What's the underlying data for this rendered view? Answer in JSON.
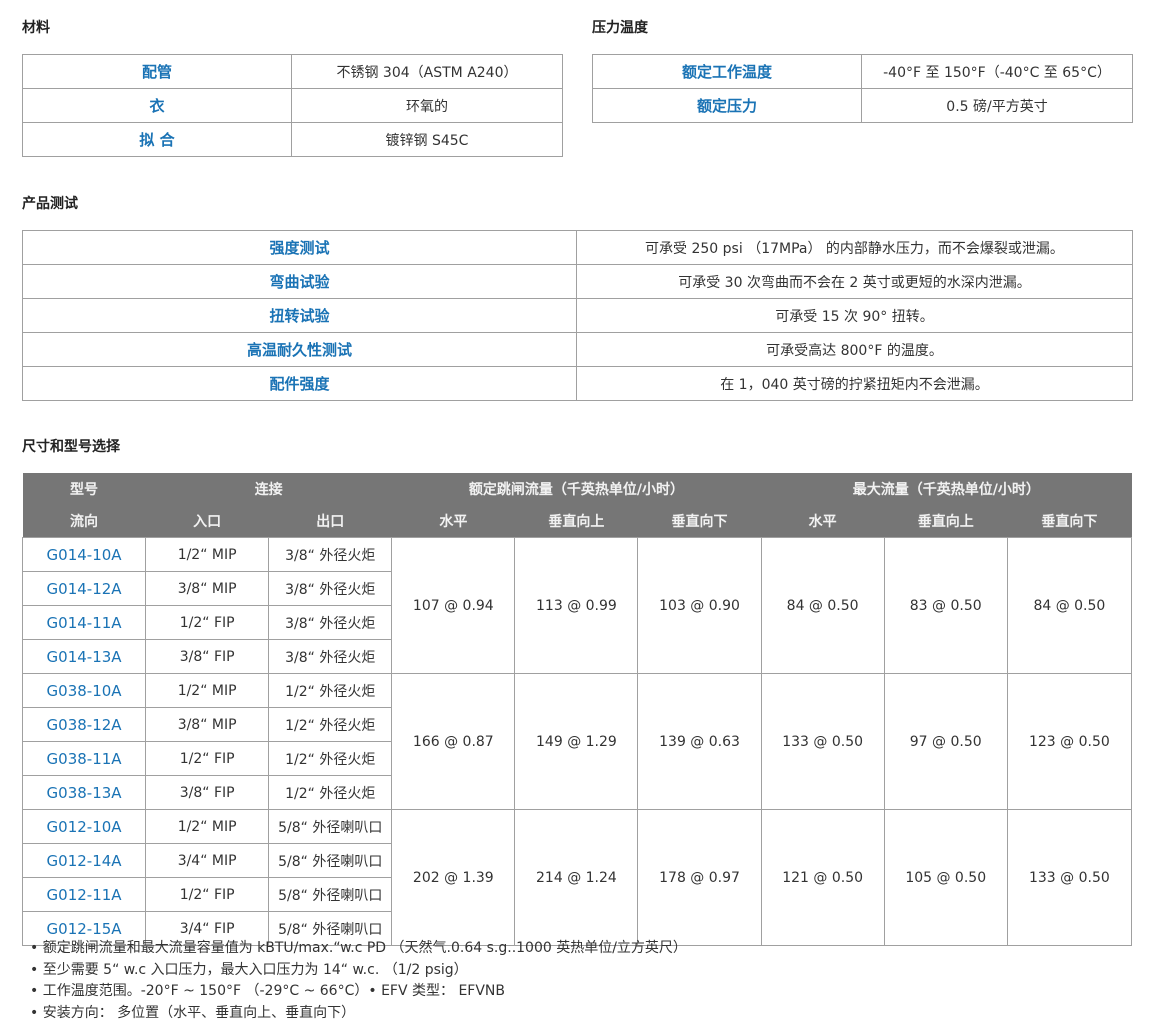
{
  "sections": {
    "materials": "材料",
    "pressure_temp": "压力温度",
    "product_test": "产品测试",
    "size_model": "尺寸和型号选择"
  },
  "materials": [
    {
      "label": "配管",
      "value": "不锈钢 304（ASTM A240）"
    },
    {
      "label": "衣",
      "value": "环氧的"
    },
    {
      "label": "拟 合",
      "value": "镀锌钢 S45C"
    }
  ],
  "pressure_temp": [
    {
      "label": "额定工作温度",
      "value": "-40°F 至 150°F（-40°C 至 65°C）"
    },
    {
      "label": "额定压力",
      "value": "0.5 磅/平方英寸"
    }
  ],
  "tests": [
    {
      "label": "强度测试",
      "value": "可承受 250 psi （17MPa） 的内部静水压力，而不会爆裂或泄漏。"
    },
    {
      "label": "弯曲试验",
      "value": "可承受 30 次弯曲而不会在 2 英寸或更短的水深内泄漏。"
    },
    {
      "label": "扭转试验",
      "value": "可承受 15 次 90° 扭转。"
    },
    {
      "label": "高温耐久性测试",
      "value": "可承受高达 800°F 的温度。"
    },
    {
      "label": "配件强度",
      "value": "在 1，040 英寸磅的拧紧扭矩内不会泄漏。"
    }
  ],
  "size_table": {
    "header1": {
      "model": "型号",
      "connection": "连接",
      "rated_flow": "额定跳闸流量（千英热单位/小时）",
      "max_flow": "最大流量（千英热单位/小时）"
    },
    "header2": {
      "flow_dir": "流向",
      "inlet": "入口",
      "outlet": "出口",
      "horizontal": "水平",
      "vertical_up": "垂直向上",
      "vertical_down": "垂直向下",
      "horizontal2": "水平",
      "vertical_up2": "垂直向上",
      "vertical_down2": "垂直向下"
    },
    "groups": [
      {
        "rows": [
          {
            "model": "G014-10A",
            "inlet": "1/2“ MIP",
            "outlet": "3/8“ 外径火炬"
          },
          {
            "model": "G014-12A",
            "inlet": "3/8“ MIP",
            "outlet": "3/8“ 外径火炬"
          },
          {
            "model": "G014-11A",
            "inlet": "1/2“ FIP",
            "outlet": "3/8“ 外径火炬"
          },
          {
            "model": "G014-13A",
            "inlet": "3/8“ FIP",
            "outlet": "3/8“ 外径火炬"
          }
        ],
        "rated_h": "107 @ 0.94",
        "rated_up": "113 @ 0.99",
        "rated_down": "103 @ 0.90",
        "max_h": "84 @ 0.50",
        "max_up": "83 @ 0.50",
        "max_down": "84 @ 0.50"
      },
      {
        "rows": [
          {
            "model": "G038-10A",
            "inlet": "1/2“ MIP",
            "outlet": "1/2“ 外径火炬"
          },
          {
            "model": "G038-12A",
            "inlet": "3/8“ MIP",
            "outlet": "1/2“ 外径火炬"
          },
          {
            "model": "G038-11A",
            "inlet": "1/2“ FIP",
            "outlet": "1/2“ 外径火炬"
          },
          {
            "model": "G038-13A",
            "inlet": "3/8“ FIP",
            "outlet": "1/2“ 外径火炬"
          }
        ],
        "rated_h": "166 @ 0.87",
        "rated_up": "149 @ 1.29",
        "rated_down": "139 @ 0.63",
        "max_h": "133 @ 0.50",
        "max_up": "97 @ 0.50",
        "max_down": "123 @ 0.50"
      },
      {
        "rows": [
          {
            "model": "G012-10A",
            "inlet": "1/2“ MIP",
            "outlet": "5/8“ 外径喇叭口"
          },
          {
            "model": "G012-14A",
            "inlet": "3/4“ MIP",
            "outlet": "5/8“ 外径喇叭口"
          },
          {
            "model": "G012-11A",
            "inlet": "1/2“ FIP",
            "outlet": "5/8“ 外径喇叭口"
          },
          {
            "model": "G012-15A",
            "inlet": "3/4“ FIP",
            "outlet": "5/8“ 外径喇叭口"
          }
        ],
        "rated_h": "202 @ 1.39",
        "rated_up": "214 @ 1.24",
        "rated_down": "178 @ 0.97",
        "max_h": "121 @ 0.50",
        "max_up": "105 @ 0.50",
        "max_down": "133 @ 0.50"
      }
    ]
  },
  "notes": [
    "额定跳闸流量和最大流量容量值为 kBTU/max.“w.c PD （天然气.0.64 s.g..1000 英热单位/立方英尺）",
    "至少需要 5“ w.c 入口压力，最大入口压力为 14“ w.c. （1/2 psig）",
    "工作温度范围。-20°F ~ 150°F （-29°C ~ 66°C）• EFV 类型： EFVNB",
    "安装方向： 多位置（水平、垂直向上、垂直向下）"
  ],
  "colors": {
    "label_blue": "#1a73b5",
    "header_gray": "#767676",
    "border": "#a0a0a0"
  }
}
